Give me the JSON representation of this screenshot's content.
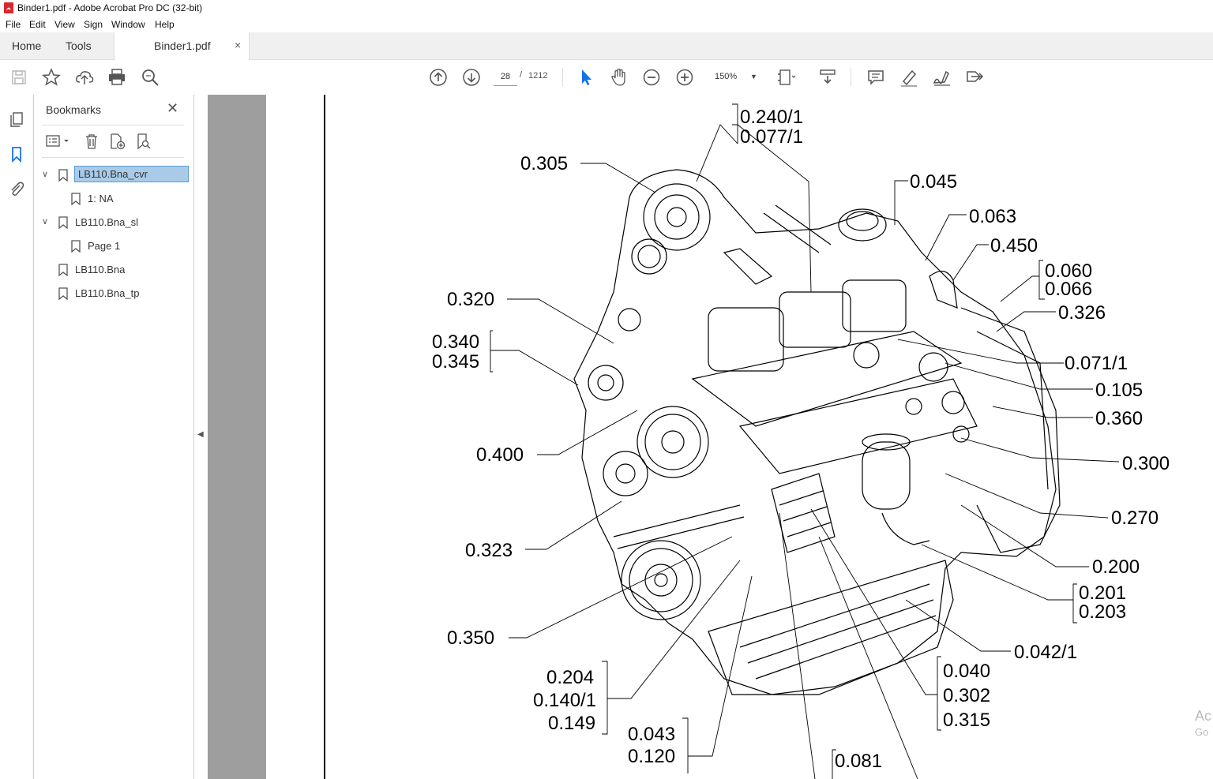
{
  "window": {
    "title": "Binder1.pdf - Adobe Acrobat Pro DC (32-bit)"
  },
  "menu": [
    "File",
    "Edit",
    "View",
    "Sign",
    "Window",
    "Help"
  ],
  "tabs": {
    "home": "Home",
    "tools": "Tools",
    "document": "Binder1.pdf",
    "close_glyph": "×"
  },
  "toolbar": {
    "page_current": "28",
    "page_sep": "/",
    "page_total": "1212",
    "zoom": "150%"
  },
  "bookmarks": {
    "title": "Bookmarks",
    "close_glyph": "✕",
    "items": [
      {
        "label": "LB110.Bna_cvr",
        "level": 0,
        "expanded": true,
        "selected": true
      },
      {
        "label": "1: NA",
        "level": 1
      },
      {
        "label": "LB110.Bna_sl",
        "level": 0,
        "expanded": true
      },
      {
        "label": "Page 1",
        "level": 1
      },
      {
        "label": "LB110.Bna",
        "level": 0
      },
      {
        "label": "LB110.Bna_tp",
        "level": 0
      }
    ]
  },
  "callouts": {
    "c0240_1": "0.240/1",
    "c0077_1": "0.077/1",
    "c0305": "0.305",
    "c0045": "0.045",
    "c0063": "0.063",
    "c0450": "0.450",
    "c0060": "0.060",
    "c0066": "0.066",
    "c0326": "0.326",
    "c0320": "0.320",
    "c0340": "0.340",
    "c0345": "0.345",
    "c0071_1": "0.071/1",
    "c0105": "0.105",
    "c0360": "0.360",
    "c0300": "0.300",
    "c0400": "0.400",
    "c0270": "0.270",
    "c0323": "0.323",
    "c0200": "0.200",
    "c0201": "0.201",
    "c0203": "0.203",
    "c0350": "0.350",
    "c0042_1": "0.042/1",
    "c0204": "0.204",
    "c0140_1": "0.140/1",
    "c0149": "0.149",
    "c0040": "0.040",
    "c0302": "0.302",
    "c0315": "0.315",
    "c0043": "0.043",
    "c0120": "0.120",
    "c0081": "0.081"
  },
  "watermark": {
    "line1": "Ac",
    "line2": "Go"
  },
  "colors": {
    "accent": "#1473e6",
    "selection": "#a9cbe8",
    "doc_gray": "#9e9e9e"
  }
}
